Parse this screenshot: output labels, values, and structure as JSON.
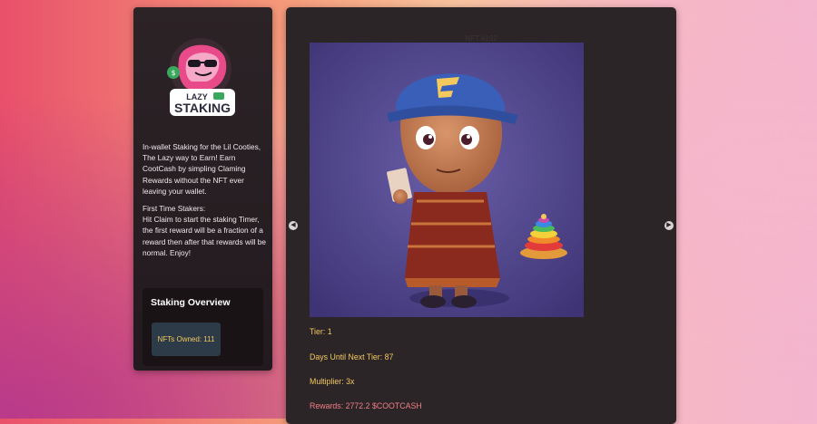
{
  "sidebar": {
    "logo": {
      "line1": "LAZY",
      "line2": "STAKING"
    },
    "intro_paragraph": "In-wallet Staking for the Lil Cooties, The Lazy way to Earn! Earn CootCash by simpling Claming Rewards without the NFT ever leaving your wallet.",
    "first_time_heading": "First Time Stakers:",
    "first_time_text": "Hit Claim to start the staking Timer, the first reward will be a fraction of a reward then after that rewards will be normal. Enjoy!",
    "overview": {
      "title": "Staking Overview",
      "nfts_owned": "NFTs Owned: 111"
    }
  },
  "nft": {
    "title": "NFT #192",
    "tier": "Tier: 1",
    "days_until_next_tier": "Days Until Next Tier: 87",
    "multiplier": "Multiplier: 3x",
    "rewards": "Rewards: 2772.2 $COOTCASH"
  },
  "nav": {
    "prev_icon": "chevron-left-icon",
    "next_icon": "chevron-right-icon"
  },
  "colors": {
    "stat_text": "#f0c860",
    "rewards_text": "#ee7f86",
    "card_bg": "#2c2528",
    "overview_box": "#2d3b48"
  }
}
